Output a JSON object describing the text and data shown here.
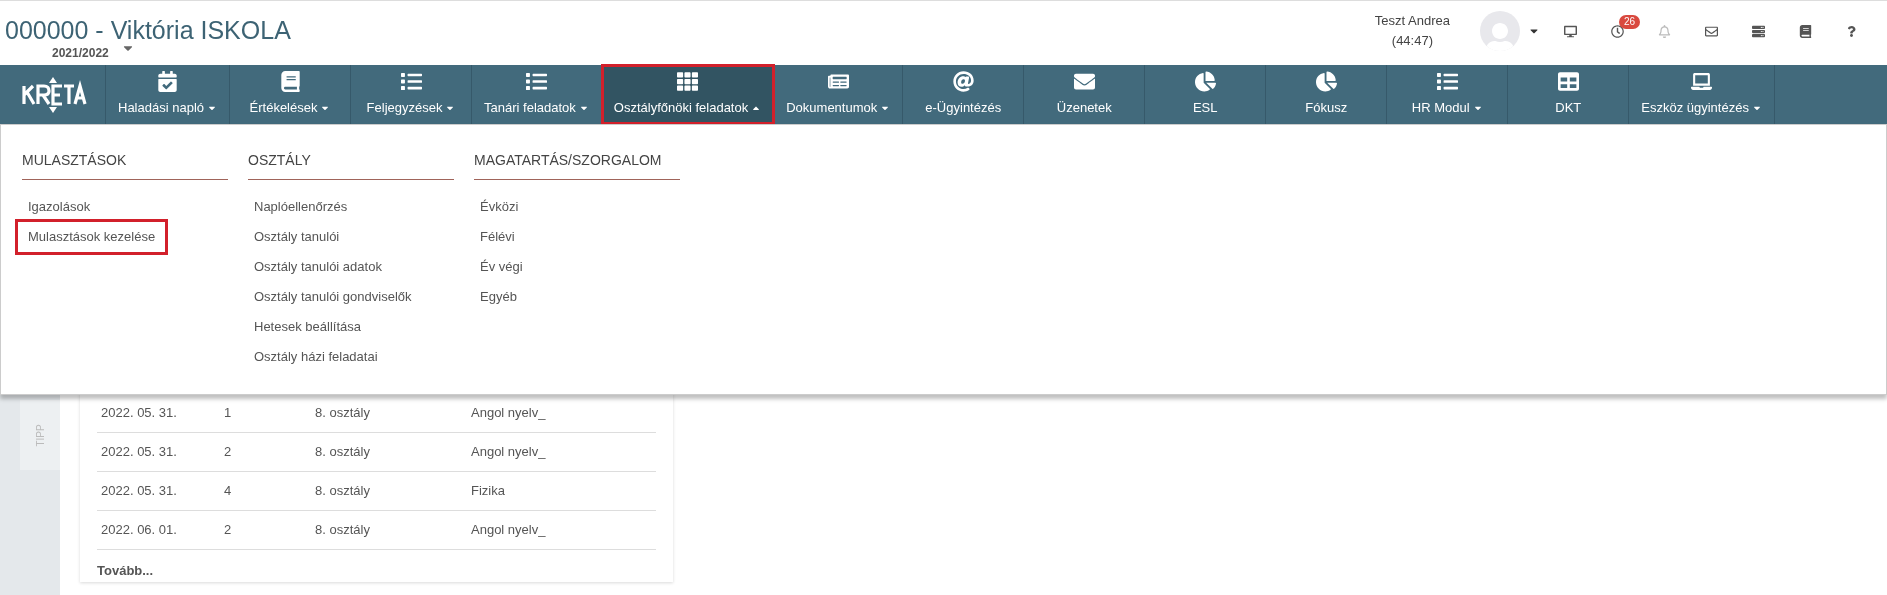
{
  "header": {
    "title": "000000 - Viktória ISKOLA",
    "school_year": "2021/2022",
    "user": {
      "name": "Teszt Andrea",
      "session_time": "(44:47)"
    },
    "notification_badge": "26"
  },
  "nav": [
    {
      "label": "Haladási napló",
      "has_caret": true,
      "selected": false,
      "highlighted": false
    },
    {
      "label": "Értékelések",
      "has_caret": true,
      "selected": false,
      "highlighted": false
    },
    {
      "label": "Feljegyzések",
      "has_caret": true,
      "selected": false,
      "highlighted": false
    },
    {
      "label": "Tanári feladatok",
      "has_caret": true,
      "selected": false,
      "highlighted": false
    },
    {
      "label": "Osztályfőnöki feladatok",
      "has_caret": true,
      "selected": true,
      "highlighted": true
    },
    {
      "label": "Dokumentumok",
      "has_caret": true,
      "selected": false,
      "highlighted": false
    },
    {
      "label": "e-Ügyintézés",
      "has_caret": false,
      "selected": false,
      "highlighted": false
    },
    {
      "label": "Üzenetek",
      "has_caret": false,
      "selected": false,
      "highlighted": false
    },
    {
      "label": "ESL",
      "has_caret": false,
      "selected": false,
      "highlighted": false
    },
    {
      "label": "Fókusz",
      "has_caret": false,
      "selected": false,
      "highlighted": false
    },
    {
      "label": "HR Modul",
      "has_caret": true,
      "selected": false,
      "highlighted": false
    },
    {
      "label": "DKT",
      "has_caret": false,
      "selected": false,
      "highlighted": false
    },
    {
      "label": "Eszköz ügyintézés",
      "has_caret": true,
      "selected": false,
      "highlighted": false
    }
  ],
  "dropdown": [
    {
      "heading": "MULASZTÁSOK",
      "items": [
        {
          "label": "Igazolások",
          "highlighted": false
        },
        {
          "label": "Mulasztások kezelése",
          "highlighted": true
        }
      ]
    },
    {
      "heading": "OSZTÁLY",
      "items": [
        {
          "label": "Naplóellenőrzés",
          "highlighted": false
        },
        {
          "label": "Osztály tanulói",
          "highlighted": false
        },
        {
          "label": "Osztály tanulói adatok",
          "highlighted": false
        },
        {
          "label": "Osztály tanulói gondviselők",
          "highlighted": false
        },
        {
          "label": "Hetesek beállítása",
          "highlighted": false
        },
        {
          "label": "Osztály házi feladatai",
          "highlighted": false
        }
      ]
    },
    {
      "heading": "MAGATARTÁS/SZORGALOM",
      "items": [
        {
          "label": "Évközi",
          "highlighted": false
        },
        {
          "label": "Félévi",
          "highlighted": false
        },
        {
          "label": "Év végi",
          "highlighted": false
        },
        {
          "label": "Egyéb",
          "highlighted": false
        }
      ]
    }
  ],
  "side_tab": "TIPP",
  "table": {
    "rows": [
      [
        "2022. 05. 31.",
        "1",
        "8. osztály",
        "Angol nyelv_"
      ],
      [
        "2022. 05. 31.",
        "2",
        "8. osztály",
        "Angol nyelv_"
      ],
      [
        "2022. 05. 31.",
        "4",
        "8. osztály",
        "Fizika"
      ],
      [
        "2022. 06. 01.",
        "2",
        "8. osztály",
        "Angol nyelv_"
      ]
    ],
    "more_link": "Tovább..."
  }
}
